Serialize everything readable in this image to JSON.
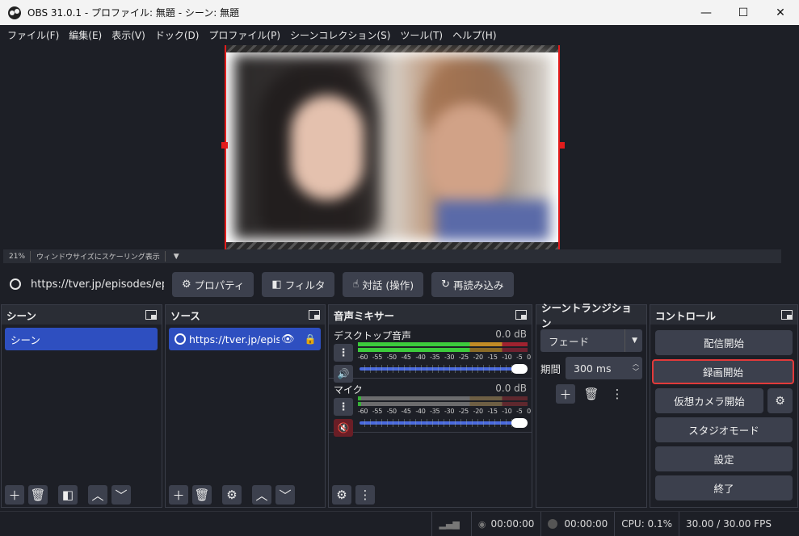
{
  "window": {
    "title": "OBS 31.0.1 - プロファイル: 無題 - シーン: 無題",
    "minimize": "—",
    "maximize": "☐",
    "close": "✕"
  },
  "menu": [
    "ファイル(F)",
    "編集(E)",
    "表示(V)",
    "ドック(D)",
    "プロファイル(P)",
    "シーンコレクション(S)",
    "ツール(T)",
    "ヘルプ(H)"
  ],
  "preview": {
    "zoom": "21%",
    "scaling": "ウィンドウサイズにスケーリング表示"
  },
  "context": {
    "source_url": "https://tver.jp/episodes/ep",
    "properties": "プロパティ",
    "filters": "フィルタ",
    "interact": "対話 (操作)",
    "refresh": "再読み込み"
  },
  "scenes": {
    "title": "シーン",
    "items": [
      "シーン"
    ]
  },
  "sources": {
    "title": "ソース",
    "items": [
      "https://tver.jp/episodes"
    ]
  },
  "mixer": {
    "title": "音声ミキサー",
    "channels": [
      {
        "name": "デスクトップ音声",
        "db": "0.0 dB",
        "muted": false,
        "level": 0.66
      },
      {
        "name": "マイク",
        "db": "0.0 dB",
        "muted": true,
        "level": 0.02
      }
    ],
    "ticks": [
      "-60",
      "-55",
      "-50",
      "-45",
      "-40",
      "-35",
      "-30",
      "-25",
      "-20",
      "-15",
      "-10",
      "-5",
      "0"
    ]
  },
  "transitions": {
    "title": "シーントランジション",
    "selected": "フェード",
    "duration_label": "期間",
    "duration": "300 ms"
  },
  "controls": {
    "title": "コントロール",
    "start_stream": "配信開始",
    "start_record": "録画開始",
    "virtual_camera": "仮想カメラ開始",
    "studio_mode": "スタジオモード",
    "settings": "設定",
    "exit": "終了"
  },
  "status": {
    "stream_time": "00:00:00",
    "record_time": "00:00:00",
    "cpu": "CPU: 0.1%",
    "fps": "30.00 / 30.00 FPS"
  },
  "colors": {
    "accent": "#2e4fc0",
    "highlight": "#e23a3a",
    "background": "#1d1f26"
  }
}
